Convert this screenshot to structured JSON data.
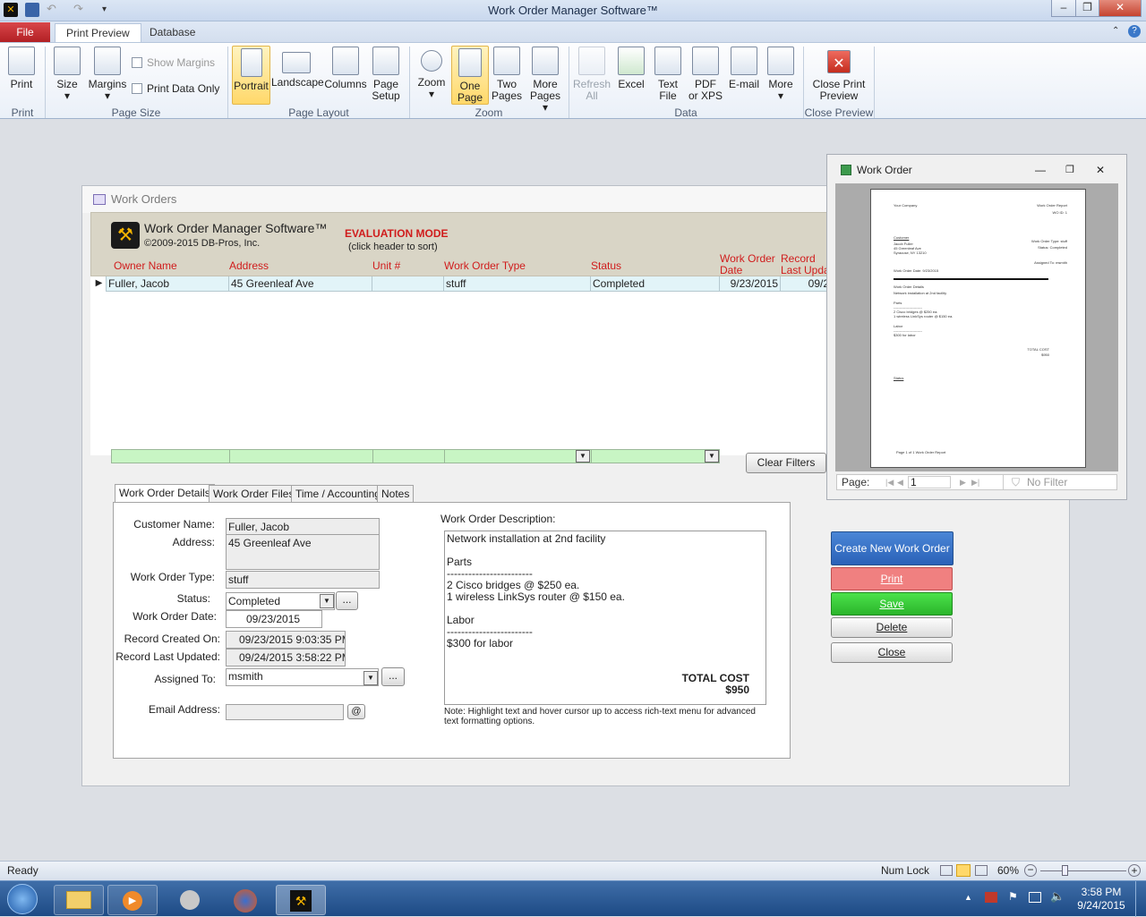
{
  "window": {
    "title": "Work Order Manager Software™"
  },
  "ribbon": {
    "tabs": [
      "File",
      "Print Preview",
      "Database"
    ],
    "buttons": {
      "print": "Print",
      "size": "Size",
      "margins": "Margins",
      "show_margins": "Show Margins",
      "print_data_only": "Print Data Only",
      "portrait": "Portrait",
      "landscape": "Landscape",
      "columns": "Columns",
      "page_setup_1": "Page",
      "page_setup_2": "Setup",
      "zoom": "Zoom",
      "one_page_1": "One",
      "one_page_2": "Page",
      "two_pages_1": "Two",
      "two_pages_2": "Pages",
      "more_pages_1": "More",
      "more_pages_2": "Pages",
      "refresh_1": "Refresh",
      "refresh_2": "All",
      "excel": "Excel",
      "text_file_1": "Text",
      "text_file_2": "File",
      "pdf_1": "PDF",
      "pdf_2": "or XPS",
      "email": "E-mail",
      "more": "More",
      "close_1": "Close Print",
      "close_2": "Preview"
    },
    "groups": {
      "print": "Print",
      "page_size": "Page Size",
      "page_layout": "Page Layout",
      "zoom": "Zoom",
      "data": "Data",
      "close_preview": "Close Preview"
    }
  },
  "form": {
    "caption": "Work Orders",
    "app_name": "Work Order Manager Software™",
    "copyright": "©2009-2015 DB-Pros, Inc.",
    "eval_mode": "EVALUATION MODE",
    "sort_hint": "(click header to sort)",
    "columns": {
      "owner": "Owner Name",
      "address": "Address",
      "unit": "Unit #",
      "type": "Work Order Type",
      "status": "Status",
      "date_1": "Work Order",
      "date_2": "Date",
      "updated_1": "Record",
      "updated_2": "Last Updat"
    },
    "rows": [
      {
        "owner": "Fuller, Jacob",
        "address": "45 Greenleaf Ave",
        "unit": "",
        "type": "stuff",
        "status": "Completed",
        "date": "9/23/2015",
        "updated": "09/2"
      }
    ],
    "clear_filters": "Clear Filters",
    "tabs": [
      "Work Order Details",
      "Work Order Files",
      "Time / Accounting",
      "Notes"
    ],
    "details": {
      "customer_label": "Customer Name:",
      "customer": "Fuller, Jacob",
      "address_label": "Address:",
      "address": "45 Greenleaf Ave",
      "type_label": "Work Order Type:",
      "type": "stuff",
      "status_label": "Status:",
      "status": "Completed",
      "date_label": "Work Order Date:",
      "date": "09/23/2015",
      "created_label": "Record Created On:",
      "created": "09/23/2015 9:03:35 PM",
      "updated_label": "Record Last Updated:",
      "updated": "09/24/2015 3:58:22 PM",
      "assigned_label": "Assigned To:",
      "assigned": "msmith",
      "email_label": "Email Address:",
      "email": "",
      "desc_label": "Work Order Description:",
      "desc_lines": [
        "Network installation at 2nd facility",
        "",
        "Parts",
        "------------------------",
        "2 Cisco bridges @ $250 ea.",
        "1 wireless LinkSys router @ $150 ea.",
        "",
        "Labor",
        "------------------------",
        "$300 for labor"
      ],
      "total_label": "TOTAL COST",
      "total": "$950",
      "note": "Note: Highlight text and hover cursor up to access rich-text menu for advanced text formatting options."
    },
    "actions": {
      "create": "Create New Work Order",
      "print": "Print",
      "save": "Save",
      "delete": "Delete",
      "close": "Close"
    }
  },
  "report_window": {
    "title": "Work Order",
    "page_label": "Page:",
    "page_value": "1",
    "filter": "No Filter",
    "page": {
      "company": "Your Company",
      "report_title": "Work Order Report",
      "wo_id": "WO ID: 1",
      "customer_heading": "Customer",
      "customer_lines": [
        "Jacob Fuller",
        "45 Greenleaf Ave",
        "Syracuse, NY 13210"
      ],
      "type_line": "Work Order Type: stuff",
      "status_line": "Status: Completed",
      "assigned_line": "Assigned To: msmith",
      "date_line": "Work Order Date: 9/23/2015",
      "details_heading": "Work Order Details",
      "details_lines": [
        "Network installation at 2nd facility",
        "",
        "Parts",
        "------------------------",
        "2 Cisco bridges @ $250 ea.",
        "1 wireless LinkSys router @ $150 ea.",
        "",
        "Labor",
        "------------------------",
        "$300 for labor"
      ],
      "total_label": "TOTAL COST",
      "total": "$950",
      "status_heading": "Status",
      "footer": "Page 1 of 1 Work Order Report"
    }
  },
  "statusbar": {
    "left": "Ready",
    "num_lock": "Num Lock",
    "zoom": "60%"
  },
  "taskbar": {
    "time": "3:58 PM",
    "date": "9/24/2015"
  },
  "colors": {
    "file_tab": "#c0282c",
    "header_bg": "#d9d5c6",
    "column_header": "#d01c1c",
    "eval_mode": "#d01c1c",
    "create_btn": "#2f6fc3",
    "print_btn": "#f08080",
    "save_btn": "#3dcf3d",
    "filter_row": "#c8f5c4"
  },
  "icons": [
    "save-icon",
    "undo-icon",
    "redo-icon",
    "printer-icon",
    "magnifier-icon",
    "excel-icon",
    "pdf-icon",
    "email-icon",
    "close-x-icon",
    "start-orb-icon",
    "folder-icon",
    "media-player-icon",
    "firefox-icon",
    "app-logo-icon"
  ]
}
